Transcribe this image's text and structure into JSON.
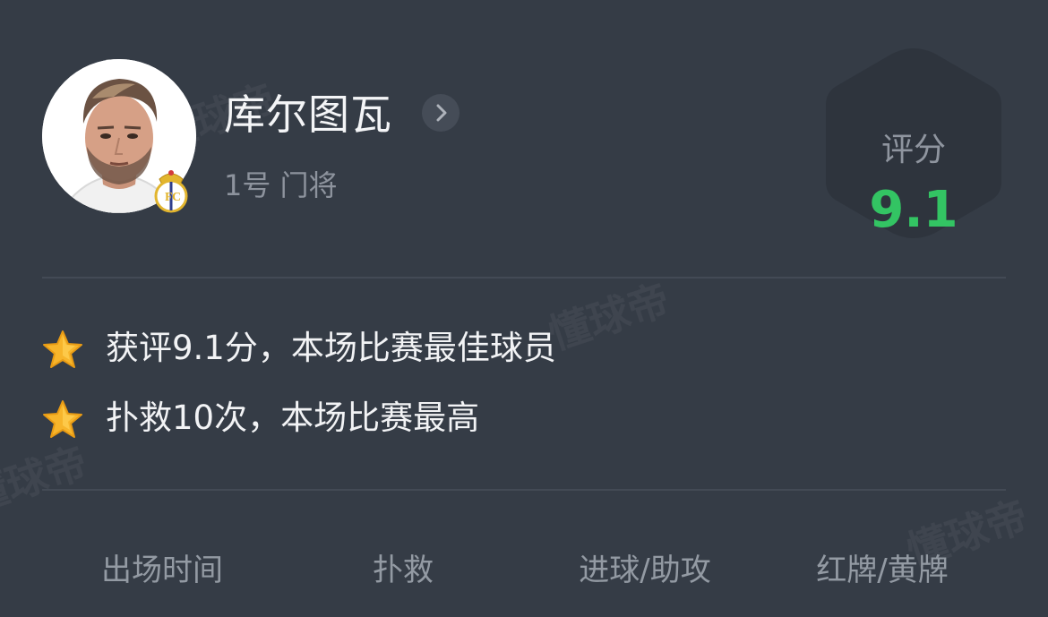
{
  "watermark": "懂球帝",
  "player": {
    "name": "库尔图瓦",
    "meta": "1号 门将"
  },
  "rating": {
    "label": "评分",
    "value": "9.1"
  },
  "highlights": [
    {
      "icon": "star-icon",
      "text": "获评9.1分，本场比赛最佳球员"
    },
    {
      "icon": "star-icon",
      "text": "扑救10次，本场比赛最高"
    }
  ],
  "stats": {
    "headers": [
      "出场时间",
      "扑救",
      "进球/助攻",
      "红牌/黄牌"
    ]
  },
  "colors": {
    "background": "#353c46",
    "rating_green": "#33c463",
    "muted_text": "#8d939d"
  }
}
